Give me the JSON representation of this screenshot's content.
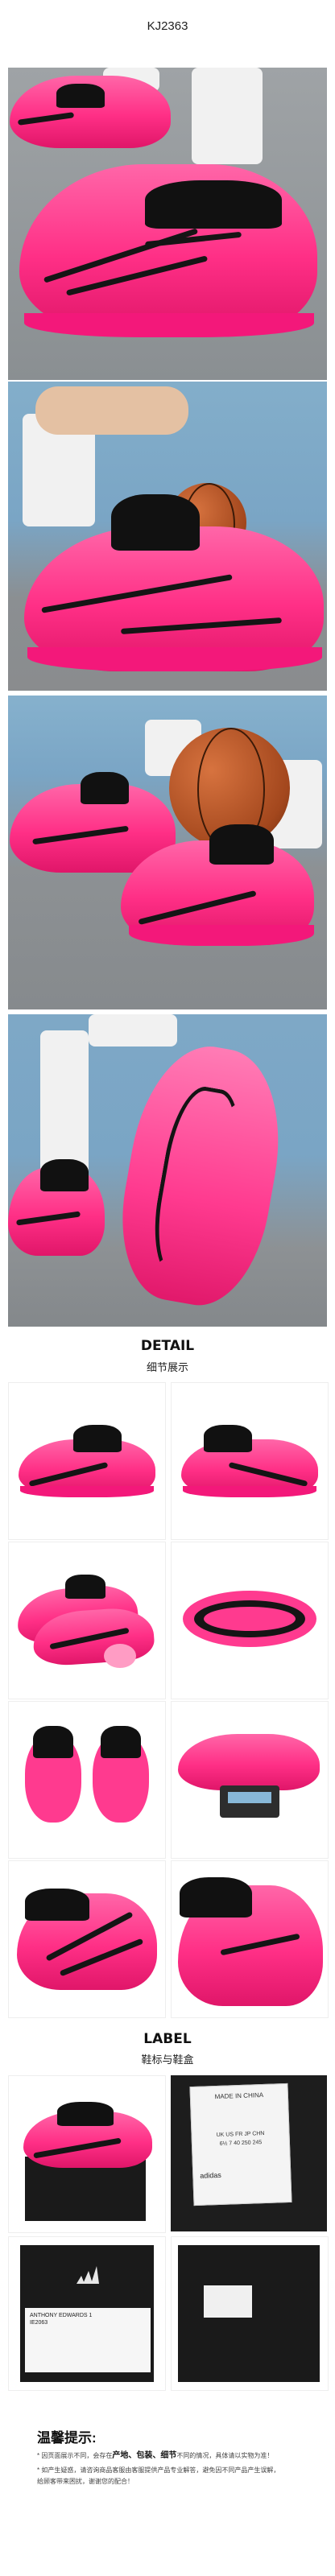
{
  "header": {
    "sku": "KJ2363"
  },
  "detail_section": {
    "title_en": "DETAIL",
    "title_cn": "细节展示"
  },
  "label_section": {
    "title_en": "LABEL",
    "title_cn": "鞋标与鞋盒"
  },
  "tips": {
    "title": "温馨提示:",
    "line1_a": "* 因页面展示不同，会存在",
    "line1_b": "产地、包装、细节",
    "line1_c": "不同的情况，具体请以实物为准！",
    "line2": "* 如产生疑惑，请咨询商品客服由客服提供产品专业解答，避免因不同产品产生误解，",
    "line3": "  给顾客带来困扰，谢谢您的配合！"
  },
  "labels": {
    "made_in": "MADE IN CHINA",
    "size_row": "UK  US  FR  JP  CHN",
    "size_vals": "6½  7  40  250  245",
    "brand": "adidas",
    "model": "ANTHONY EDWARDS 1",
    "code": "IE2063"
  },
  "colors": {
    "shoe_pink": "#ff2f86",
    "shoe_black": "#151515",
    "floor": "#8e9497",
    "wall": "#7aa5c5"
  }
}
